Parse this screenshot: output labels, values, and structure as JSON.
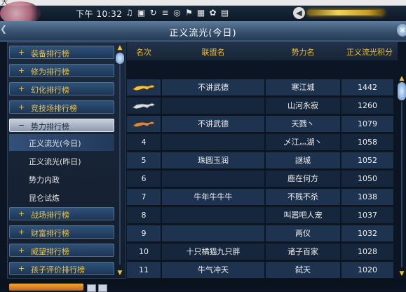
{
  "top_strip": {
    "text": "大"
  },
  "hud": {
    "time": "下午 10:32",
    "icons": [
      "music-icon",
      "save-icon",
      "refresh-icon",
      "menu-icon",
      "camera-icon",
      "flag-icon",
      "grid-icon",
      "settings-icon",
      "screenshot-icon"
    ],
    "dial_label": "◀"
  },
  "window": {
    "title": "正义流光(今日)",
    "close": "×"
  },
  "sidebar": {
    "items": [
      {
        "sign": "+",
        "label": "装备排行榜"
      },
      {
        "sign": "+",
        "label": "修为排行榜"
      },
      {
        "sign": "+",
        "label": "幻化排行榜"
      },
      {
        "sign": "+",
        "label": "竞技场排行榜"
      },
      {
        "sign": "−",
        "label": "势力排行榜",
        "expanded": true
      }
    ],
    "subitems": [
      {
        "label": "正义流光(今日)",
        "selected": true
      },
      {
        "label": "正义流光(昨日)"
      },
      {
        "label": "势力内政"
      },
      {
        "label": "昆仑试炼"
      }
    ],
    "items_after": [
      {
        "sign": "+",
        "label": "战场排行榜"
      },
      {
        "sign": "+",
        "label": "财富排行榜"
      },
      {
        "sign": "+",
        "label": "威望排行榜"
      },
      {
        "sign": "+",
        "label": "孩子评价排行榜"
      }
    ]
  },
  "table": {
    "headers": {
      "rank": "名次",
      "union": "联盟名",
      "force": "势力名",
      "score": "正义流光积分"
    },
    "rows": [
      {
        "rank": "",
        "union": "不讲武德",
        "force": "寒江城",
        "score": "1442",
        "medal": "gold"
      },
      {
        "rank": "",
        "union": "",
        "force": "山河永寂",
        "score": "1260",
        "medal": "silver"
      },
      {
        "rank": "",
        "union": "不讲武德",
        "force": "天戮丶",
        "score": "1079",
        "medal": "bronze"
      },
      {
        "rank": "4",
        "union": "",
        "force": "乄江灬湖丶",
        "score": "1058"
      },
      {
        "rank": "5",
        "union": "珠圆玉润",
        "force": "謎城",
        "score": "1052"
      },
      {
        "rank": "6",
        "union": "",
        "force": "鹿在何方",
        "score": "1050"
      },
      {
        "rank": "7",
        "union": "牛年牛牛牛",
        "force": "不贱不杀",
        "score": "1038"
      },
      {
        "rank": "8",
        "union": "",
        "force": "叫嚣吧人宠",
        "score": "1037"
      },
      {
        "rank": "9",
        "union": "",
        "force": "两仪",
        "score": "1032"
      },
      {
        "rank": "10",
        "union": "十只橘猫九只胖",
        "force": "诸子百家",
        "score": "1028"
      },
      {
        "rank": "11",
        "union": "牛气冲天",
        "force": "弑天",
        "score": "1020"
      }
    ]
  },
  "colors": {
    "accent_gold": "#f0c030",
    "row_bg": "#263e5e",
    "title_bg": "#37506e"
  }
}
